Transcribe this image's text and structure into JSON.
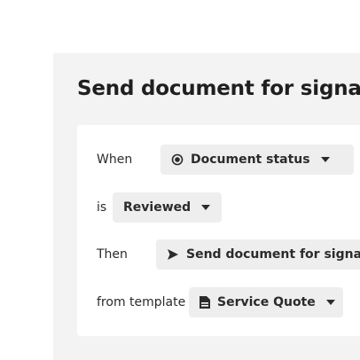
{
  "header": {
    "title": "Send document for signatu"
  },
  "rule": {
    "when_label": "When",
    "trigger_selector": {
      "label": "Document status",
      "icon": "radio-icon"
    },
    "is_label": "is",
    "status_selector": {
      "label": "Reviewed"
    },
    "then_label": "Then",
    "action_selector": {
      "label": "Send document for signature",
      "icon": "send-icon"
    },
    "template_label": "from template",
    "template_selector": {
      "label": "Service Quote",
      "icon": "document-icon"
    }
  }
}
